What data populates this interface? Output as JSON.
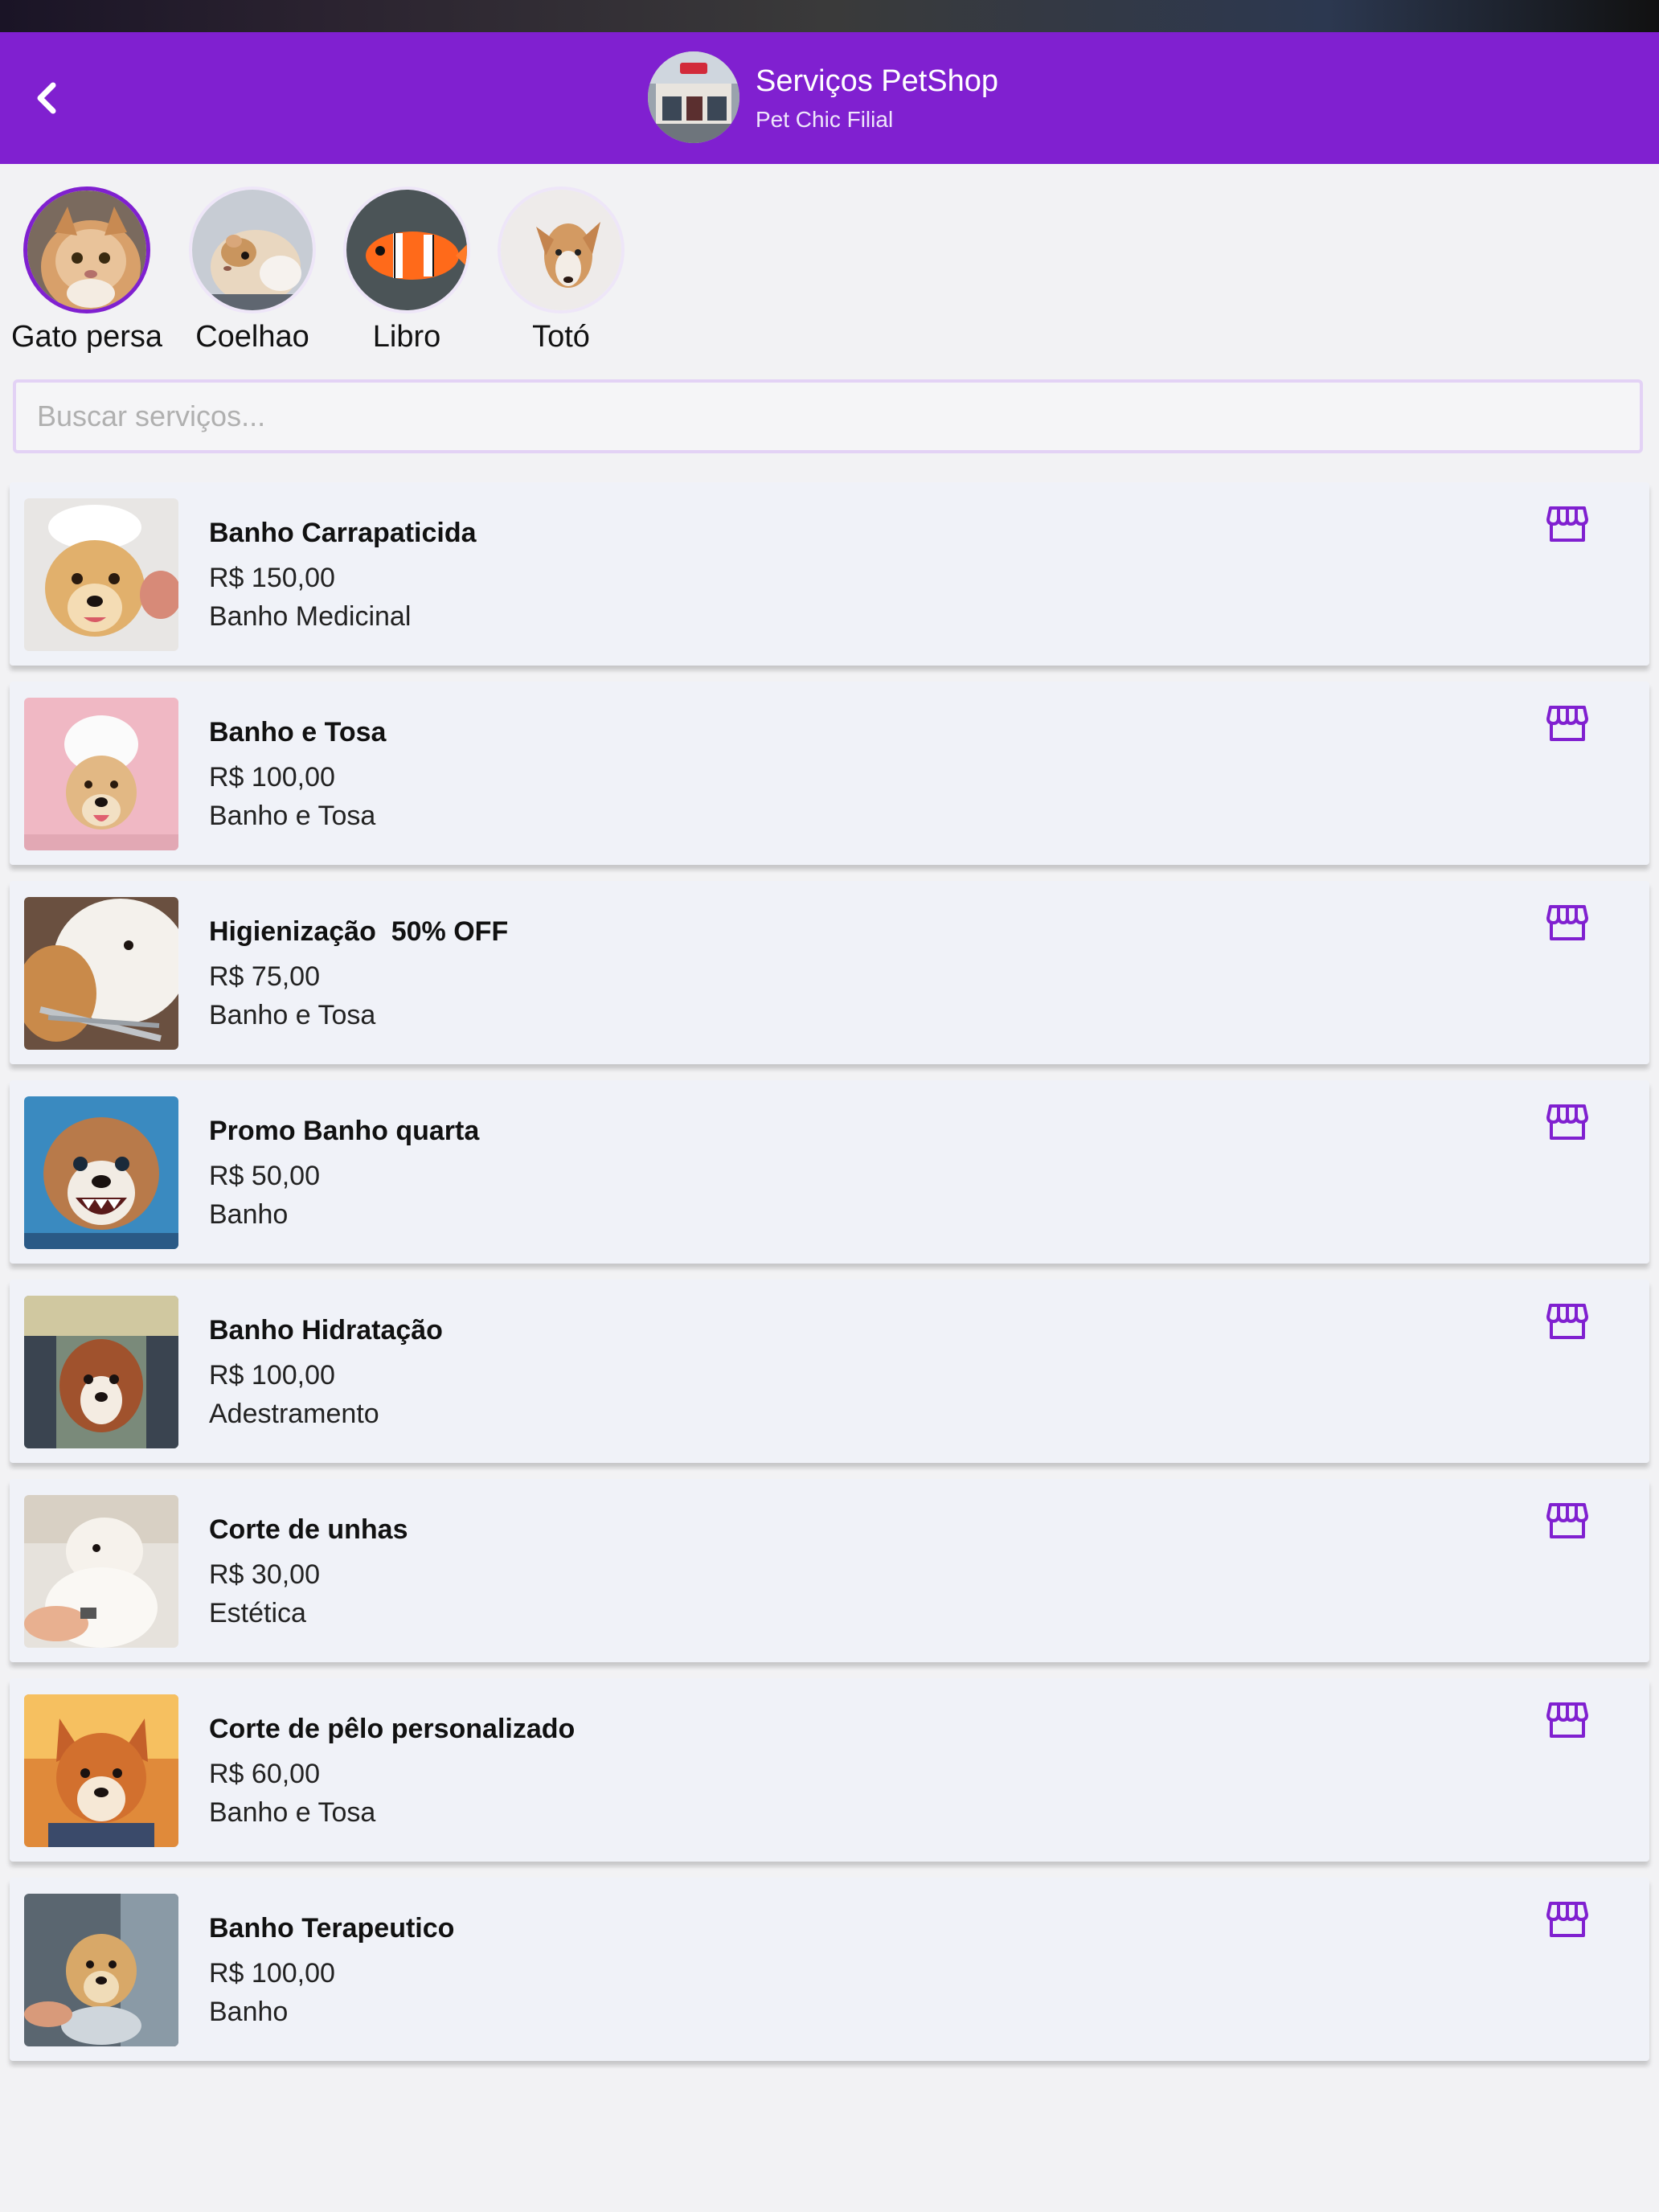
{
  "header": {
    "title": "Serviços PetShop",
    "subtitle": "Pet Chic Filial",
    "back_icon": "chevron-left-icon",
    "background_color": "#8020d0"
  },
  "pets": [
    {
      "name": "Gato persa",
      "selected": true
    },
    {
      "name": "Coelhao",
      "selected": false
    },
    {
      "name": "Libro",
      "selected": false
    },
    {
      "name": "Totó",
      "selected": false
    }
  ],
  "search": {
    "placeholder": "Buscar serviços...",
    "value": ""
  },
  "services": [
    {
      "name": "Banho Carrapaticida",
      "price": "R$ 150,00",
      "category": "Banho Medicinal",
      "action_icon": "store-icon"
    },
    {
      "name": "Banho e Tosa",
      "price": "R$ 100,00",
      "category": "Banho e Tosa",
      "action_icon": "store-icon"
    },
    {
      "name": "Higienização  50% OFF",
      "price": "R$ 75,00",
      "category": "Banho e Tosa",
      "action_icon": "store-icon"
    },
    {
      "name": "Promo Banho quarta",
      "price": "R$ 50,00",
      "category": "Banho",
      "action_icon": "store-icon"
    },
    {
      "name": "Banho Hidratação",
      "price": "R$ 100,00",
      "category": "Adestramento",
      "action_icon": "store-icon"
    },
    {
      "name": "Corte de unhas",
      "price": "R$ 30,00",
      "category": "Estética",
      "action_icon": "store-icon"
    },
    {
      "name": "Corte de pêlo personalizado",
      "price": "R$ 60,00",
      "category": "Banho e Tosa",
      "action_icon": "store-icon"
    },
    {
      "name": "Banho Terapeutico",
      "price": "R$ 100,00",
      "category": "Banho",
      "action_icon": "store-icon"
    }
  ],
  "colors": {
    "accent": "#8020d0",
    "card_background": "#f0f2f8",
    "page_background": "#f2f2f4"
  }
}
